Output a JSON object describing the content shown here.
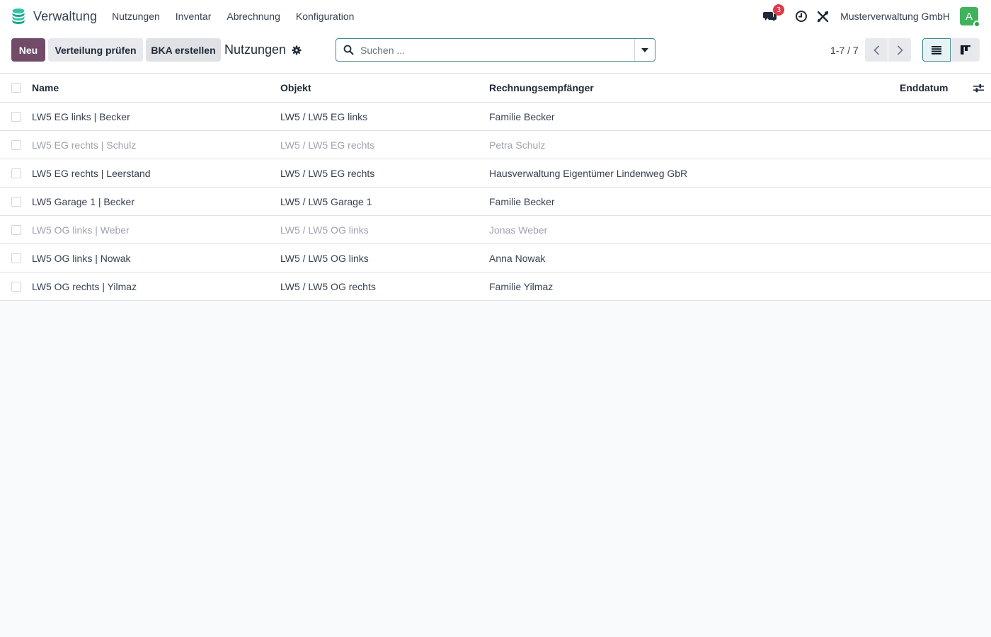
{
  "navbar": {
    "app_name": "Verwaltung",
    "menu": [
      "Nutzungen",
      "Inventar",
      "Abrechnung",
      "Konfiguration"
    ],
    "messages_badge": "3",
    "company": "Musterverwaltung GmbH",
    "avatar_letter": "A"
  },
  "toolbar": {
    "new_label": "Neu",
    "check_label": "Verteilung prüfen",
    "bka_label": "BKA erstellen",
    "title": "Nutzungen"
  },
  "search": {
    "placeholder": "Suchen ..."
  },
  "pager": {
    "value": "1-7 / 7"
  },
  "table": {
    "headers": {
      "name": "Name",
      "objekt": "Objekt",
      "empfaenger": "Rechnungsempfänger",
      "enddatum": "Enddatum"
    },
    "rows": [
      {
        "name": "LW5 EG links | Becker",
        "objekt": "LW5 / LW5 EG links",
        "empfaenger": "Familie Becker",
        "enddatum": "",
        "muted": false
      },
      {
        "name": "LW5 EG rechts | Schulz",
        "objekt": "LW5 / LW5 EG rechts",
        "empfaenger": "Petra Schulz",
        "enddatum": "",
        "muted": true
      },
      {
        "name": "LW5 EG rechts | Leerstand",
        "objekt": "LW5 / LW5 EG rechts",
        "empfaenger": "Hausverwaltung Eigentümer Lindenweg GbR",
        "enddatum": "",
        "muted": false
      },
      {
        "name": "LW5 Garage 1 | Becker",
        "objekt": "LW5 / LW5 Garage 1",
        "empfaenger": "Familie Becker",
        "enddatum": "",
        "muted": false
      },
      {
        "name": "LW5 OG links | Weber",
        "objekt": "LW5 / LW5 OG links",
        "empfaenger": "Jonas Weber",
        "enddatum": "",
        "muted": true
      },
      {
        "name": "LW5 OG links | Nowak",
        "objekt": "LW5 / LW5 OG links",
        "empfaenger": "Anna Nowak",
        "enddatum": "",
        "muted": false
      },
      {
        "name": "LW5 OG rechts | Yilmaz",
        "objekt": "LW5 / LW5 OG rechts",
        "empfaenger": "Familie Yilmaz",
        "enddatum": "",
        "muted": false
      }
    ]
  },
  "colors": {
    "primary": "#714b67",
    "accent": "#3d8a8e",
    "badge": "#e0394a",
    "avatar": "#3fb35b"
  },
  "icons": {
    "brand": "database-stack-icon",
    "messages": "chat-icon",
    "activity": "clock-icon",
    "tools": "tools-icon",
    "settings": "gear-icon",
    "search": "search-icon",
    "list_view": "list-view-icon",
    "kanban_view": "kanban-view-icon",
    "optional_columns": "sliders-icon"
  }
}
